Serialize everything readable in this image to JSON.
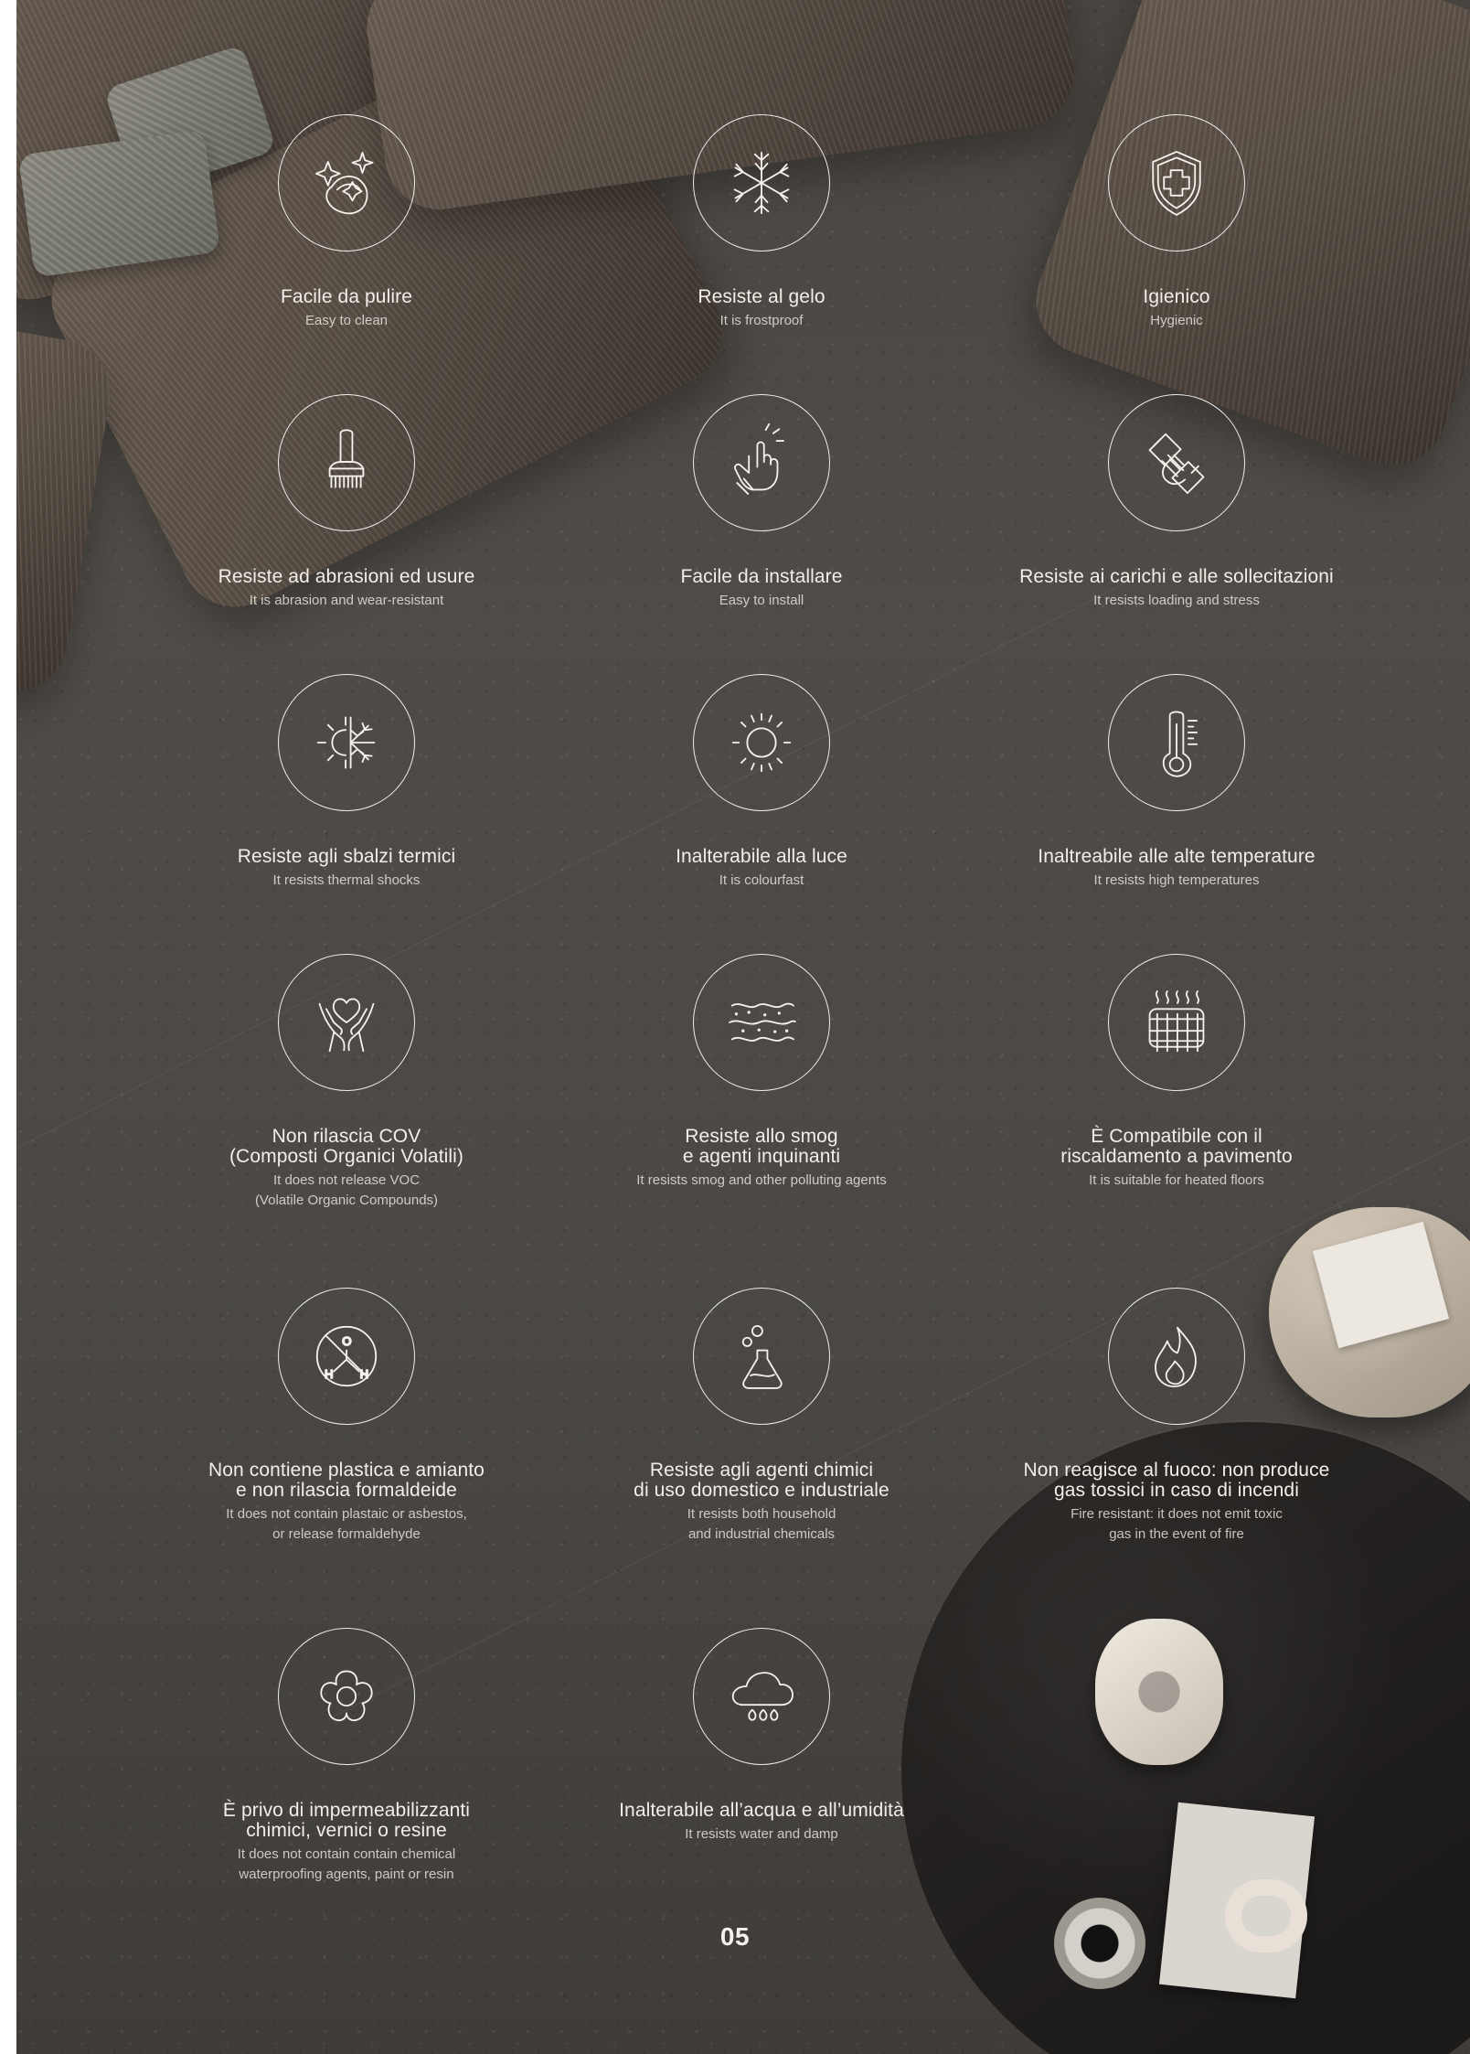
{
  "features": [
    {
      "title": "Facile da pulire",
      "subtitle": "Easy to clean",
      "icon": "soap-sparkles-icon"
    },
    {
      "title": "Resiste al gelo",
      "subtitle": "It is frostproof",
      "icon": "snowflake-icon"
    },
    {
      "title": "Igienico",
      "subtitle": "Hygienic",
      "icon": "shield-cross-icon"
    },
    {
      "title": "Resiste ad abrasioni ed usure",
      "subtitle": "It is abrasion and wear-resistant",
      "icon": "brush-icon"
    },
    {
      "title": "Facile da installare",
      "subtitle": "Easy to install",
      "icon": "hand-touch-icon"
    },
    {
      "title": "Resiste ai carichi e alle sollecitazioni",
      "subtitle": "It resists loading and stress",
      "icon": "hand-load-icon"
    },
    {
      "title": "Resiste agli sbalzi termici",
      "subtitle": "It resists thermal shocks",
      "icon": "sun-snowflake-icon"
    },
    {
      "title": "Inalterabile alla luce",
      "subtitle": "It is colourfast",
      "icon": "sun-icon"
    },
    {
      "title": "Inaltreabile alle alte temperature",
      "subtitle": "It resists high temperatures",
      "icon": "thermometer-icon"
    },
    {
      "title": "Non rilascia COV\n(Composti Organici Volatili)",
      "subtitle": "It does not release VOC\n(Volatile Organic Compounds)",
      "icon": "hands-heart-icon"
    },
    {
      "title": "Resiste allo smog\ne agenti inquinanti",
      "subtitle": "It resists smog and other polluting agents",
      "icon": "smog-waves-icon"
    },
    {
      "title": "È Compatibile con il\nriscaldamento a pavimento",
      "subtitle": "It is suitable for heated floors",
      "icon": "floor-heating-icon"
    },
    {
      "title": "Non contiene plastica e amianto\ne non rilascia formaldeide",
      "subtitle": "It does not contain plastaic or asbestos,\nor release formaldehyde",
      "icon": "no-formaldehyde-icon",
      "molecule_labels": [
        "O",
        "H",
        "H"
      ]
    },
    {
      "title": "Resiste agli agenti chimici\ndi uso domestico e industriale",
      "subtitle": "It resists both household\nand industrial chemicals",
      "icon": "flask-icon"
    },
    {
      "title": "Non reagisce al fuoco: non produce\ngas tossici in caso di incendi",
      "subtitle": "Fire resistant: it does not emit toxic\ngas in the event of fire",
      "icon": "flame-icon"
    },
    {
      "title": "È privo di impermeabilizzanti\nchimici, vernici o resine",
      "subtitle": "It does not contain contain chemical\nwaterproofing agents, paint or resin",
      "icon": "flower-icon"
    },
    {
      "title": "Inalterabile all’acqua e all’umidità",
      "subtitle": "It resists water and damp",
      "icon": "rain-cloud-icon"
    }
  ],
  "page_number": "05"
}
